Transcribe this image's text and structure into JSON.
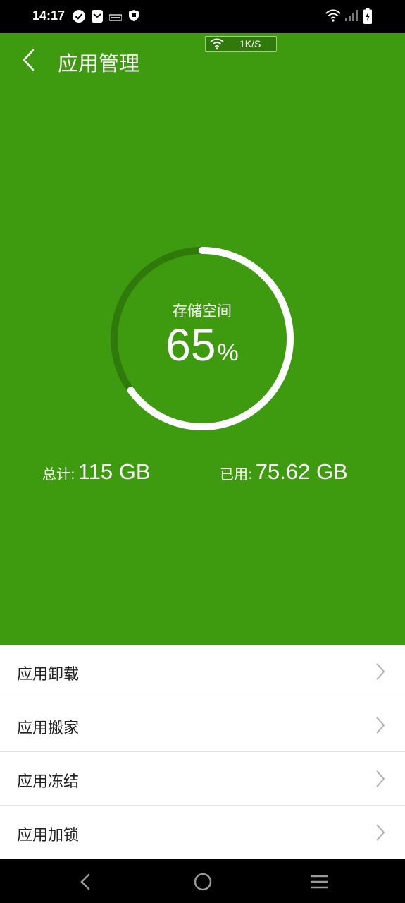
{
  "status_bar": {
    "time": "14:17",
    "icons": [
      "check-circle-icon",
      "mail-icon",
      "app-notification-icon",
      "shield-icon",
      "wifi-icon",
      "signal-icon",
      "battery-charging-icon"
    ]
  },
  "header": {
    "title": "应用管理",
    "back_icon": "chevron-left-icon",
    "network_speed": "1K/S"
  },
  "storage": {
    "label": "存储空间",
    "percent_value": "65",
    "percent_sign": "%",
    "percent_fraction": 0.65,
    "total_label": "总计:",
    "total_value": "115 GB",
    "used_label": "已用:",
    "used_value": "75.62 GB"
  },
  "menu": {
    "items": [
      {
        "label": "应用卸载"
      },
      {
        "label": "应用搬家"
      },
      {
        "label": "应用冻结"
      },
      {
        "label": "应用加锁"
      }
    ]
  },
  "nav": {
    "icons": [
      "nav-back-icon",
      "nav-home-icon",
      "nav-menu-icon"
    ]
  },
  "colors": {
    "accent_green": "#3e9b10",
    "ring_track": "#2f7a0b",
    "text_on_green": "#ffffff"
  }
}
